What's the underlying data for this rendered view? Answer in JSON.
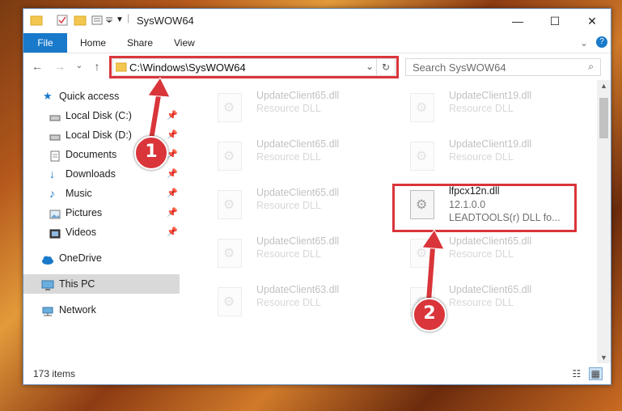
{
  "window": {
    "title": "SysWOW64"
  },
  "ribbon": {
    "file": "File",
    "tabs": [
      "Home",
      "Share",
      "View"
    ]
  },
  "address": {
    "path": "C:\\Windows\\SysWOW64"
  },
  "search": {
    "placeholder": "Search SysWOW64"
  },
  "nav": {
    "items": [
      {
        "label": "Quick access",
        "icon": "star-icon"
      },
      {
        "label": "Local Disk (C:)",
        "icon": "drive-icon"
      },
      {
        "label": "Local Disk (D:)",
        "icon": "drive-icon"
      },
      {
        "label": "Documents",
        "icon": "documents-icon"
      },
      {
        "label": "Downloads",
        "icon": "download-icon"
      },
      {
        "label": "Music",
        "icon": "music-icon"
      },
      {
        "label": "Pictures",
        "icon": "pictures-icon"
      },
      {
        "label": "Videos",
        "icon": "videos-icon"
      },
      {
        "label": "OneDrive",
        "icon": "cloud-icon"
      },
      {
        "label": "This PC",
        "icon": "computer-icon"
      },
      {
        "label": "Network",
        "icon": "network-icon"
      }
    ]
  },
  "files": [
    {
      "name": "UpdateClient65.dll",
      "desc": "Resource DLL"
    },
    {
      "name": "UpdateClient19.dll",
      "desc": "Resource DLL"
    },
    {
      "name": "UpdateClient65.dll",
      "desc": "Resource DLL"
    },
    {
      "name": "UpdateClient19.dll",
      "desc": "Resource DLL"
    },
    {
      "name": "UpdateClient65.dll",
      "desc": "Resource DLL"
    },
    {
      "name": "lfpcx12n.dll",
      "version": "12.1.0.0",
      "desc": "LEADTOOLS(r) DLL fo..."
    },
    {
      "name": "UpdateClient65.dll",
      "desc": "Resource DLL"
    },
    {
      "name": "UpdateClient65.dll",
      "desc": "Resource DLL"
    },
    {
      "name": "UpdateClient63.dll",
      "desc": "Resource DLL"
    },
    {
      "name": "UpdateClient65.dll",
      "desc": "Resource DLL"
    }
  ],
  "status": {
    "count": "173 items"
  },
  "badges": {
    "one": "1",
    "two": "2"
  },
  "colors": {
    "accent": "#1979ca",
    "highlight": "#d9353a"
  }
}
